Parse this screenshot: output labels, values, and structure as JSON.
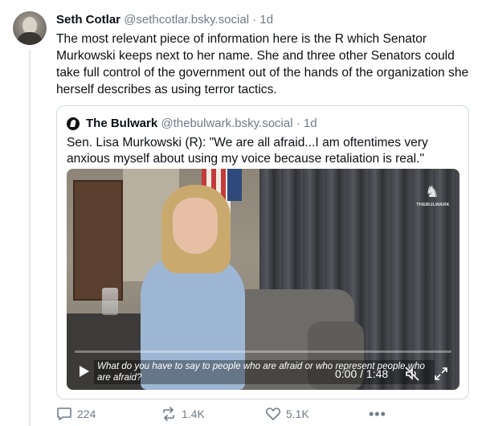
{
  "post": {
    "author_name": "Seth Cotlar",
    "author_handle": "@sethcotlar.bsky.social",
    "separator": "·",
    "time_ago": "1d",
    "text": "The most relevant piece of information here is the R which Senator Murkowski keeps next to her name. She and three other Senators could take full control of the government out of the hands of the organization she herself describes as using terror tactics."
  },
  "quote": {
    "author_name": "The Bulwark",
    "author_handle": "@thebulwark.bsky.social",
    "separator": "·",
    "time_ago": "1d",
    "text": "Sen. Lisa Murkowski (R): \"We are all afraid...I am oftentimes very anxious myself about using my voice because retaliation is real.\"",
    "video": {
      "caption": "What do you have to say to people who are afraid or who represent people who are afraid?",
      "timecode": "0:00 / 1:48",
      "progress_fraction": 0.0,
      "logo_text": "THEBULWARK"
    }
  },
  "actions": {
    "replies": "224",
    "reposts": "1.4K",
    "likes": "5.1K",
    "more": "•••"
  },
  "colors": {
    "text_primary": "#0b0f14",
    "text_secondary": "#6f7b88",
    "border": "#d4dbe2"
  }
}
